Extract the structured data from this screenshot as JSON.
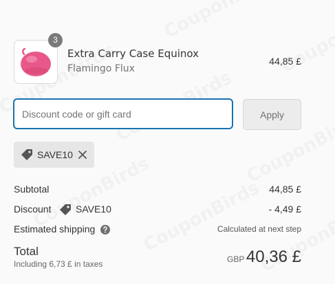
{
  "watermark": "CouponBirds",
  "line_item": {
    "quantity": "3",
    "name": "Extra Carry Case Equinox",
    "variant": "Flamingo Flux",
    "price": "44,85 £"
  },
  "discount_form": {
    "placeholder": "Discount code or gift card",
    "apply_label": "Apply"
  },
  "applied_discount": {
    "code": "SAVE10"
  },
  "summary": {
    "subtotal_label": "Subtotal",
    "subtotal_value": "44,85 £",
    "discount_label": "Discount",
    "discount_code": "SAVE10",
    "discount_value": "- 4,49 £",
    "shipping_label": "Estimated shipping",
    "shipping_value": "Calculated at next step"
  },
  "total": {
    "label": "Total",
    "tax_note": "Including 6,73 £ in taxes",
    "currency": "GBP",
    "amount": "40,36 £"
  },
  "colors": {
    "accent": "#1773b0",
    "product": "#e8588a",
    "badge": "#7a7a7a"
  },
  "icons": [
    "tag-icon",
    "close-icon",
    "help-icon"
  ]
}
